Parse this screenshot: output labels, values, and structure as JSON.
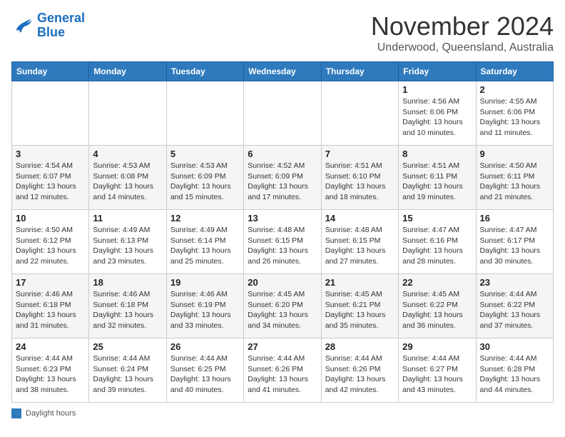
{
  "header": {
    "logo_line1": "General",
    "logo_line2": "Blue",
    "month": "November 2024",
    "location": "Underwood, Queensland, Australia"
  },
  "days_of_week": [
    "Sunday",
    "Monday",
    "Tuesday",
    "Wednesday",
    "Thursday",
    "Friday",
    "Saturday"
  ],
  "weeks": [
    [
      {
        "day": "",
        "info": ""
      },
      {
        "day": "",
        "info": ""
      },
      {
        "day": "",
        "info": ""
      },
      {
        "day": "",
        "info": ""
      },
      {
        "day": "",
        "info": ""
      },
      {
        "day": "1",
        "info": "Sunrise: 4:56 AM\nSunset: 6:06 PM\nDaylight: 13 hours\nand 10 minutes."
      },
      {
        "day": "2",
        "info": "Sunrise: 4:55 AM\nSunset: 6:06 PM\nDaylight: 13 hours\nand 11 minutes."
      }
    ],
    [
      {
        "day": "3",
        "info": "Sunrise: 4:54 AM\nSunset: 6:07 PM\nDaylight: 13 hours\nand 12 minutes."
      },
      {
        "day": "4",
        "info": "Sunrise: 4:53 AM\nSunset: 6:08 PM\nDaylight: 13 hours\nand 14 minutes."
      },
      {
        "day": "5",
        "info": "Sunrise: 4:53 AM\nSunset: 6:09 PM\nDaylight: 13 hours\nand 15 minutes."
      },
      {
        "day": "6",
        "info": "Sunrise: 4:52 AM\nSunset: 6:09 PM\nDaylight: 13 hours\nand 17 minutes."
      },
      {
        "day": "7",
        "info": "Sunrise: 4:51 AM\nSunset: 6:10 PM\nDaylight: 13 hours\nand 18 minutes."
      },
      {
        "day": "8",
        "info": "Sunrise: 4:51 AM\nSunset: 6:11 PM\nDaylight: 13 hours\nand 19 minutes."
      },
      {
        "day": "9",
        "info": "Sunrise: 4:50 AM\nSunset: 6:11 PM\nDaylight: 13 hours\nand 21 minutes."
      }
    ],
    [
      {
        "day": "10",
        "info": "Sunrise: 4:50 AM\nSunset: 6:12 PM\nDaylight: 13 hours\nand 22 minutes."
      },
      {
        "day": "11",
        "info": "Sunrise: 4:49 AM\nSunset: 6:13 PM\nDaylight: 13 hours\nand 23 minutes."
      },
      {
        "day": "12",
        "info": "Sunrise: 4:49 AM\nSunset: 6:14 PM\nDaylight: 13 hours\nand 25 minutes."
      },
      {
        "day": "13",
        "info": "Sunrise: 4:48 AM\nSunset: 6:15 PM\nDaylight: 13 hours\nand 26 minutes."
      },
      {
        "day": "14",
        "info": "Sunrise: 4:48 AM\nSunset: 6:15 PM\nDaylight: 13 hours\nand 27 minutes."
      },
      {
        "day": "15",
        "info": "Sunrise: 4:47 AM\nSunset: 6:16 PM\nDaylight: 13 hours\nand 28 minutes."
      },
      {
        "day": "16",
        "info": "Sunrise: 4:47 AM\nSunset: 6:17 PM\nDaylight: 13 hours\nand 30 minutes."
      }
    ],
    [
      {
        "day": "17",
        "info": "Sunrise: 4:46 AM\nSunset: 6:18 PM\nDaylight: 13 hours\nand 31 minutes."
      },
      {
        "day": "18",
        "info": "Sunrise: 4:46 AM\nSunset: 6:18 PM\nDaylight: 13 hours\nand 32 minutes."
      },
      {
        "day": "19",
        "info": "Sunrise: 4:46 AM\nSunset: 6:19 PM\nDaylight: 13 hours\nand 33 minutes."
      },
      {
        "day": "20",
        "info": "Sunrise: 4:45 AM\nSunset: 6:20 PM\nDaylight: 13 hours\nand 34 minutes."
      },
      {
        "day": "21",
        "info": "Sunrise: 4:45 AM\nSunset: 6:21 PM\nDaylight: 13 hours\nand 35 minutes."
      },
      {
        "day": "22",
        "info": "Sunrise: 4:45 AM\nSunset: 6:22 PM\nDaylight: 13 hours\nand 36 minutes."
      },
      {
        "day": "23",
        "info": "Sunrise: 4:44 AM\nSunset: 6:22 PM\nDaylight: 13 hours\nand 37 minutes."
      }
    ],
    [
      {
        "day": "24",
        "info": "Sunrise: 4:44 AM\nSunset: 6:23 PM\nDaylight: 13 hours\nand 38 minutes."
      },
      {
        "day": "25",
        "info": "Sunrise: 4:44 AM\nSunset: 6:24 PM\nDaylight: 13 hours\nand 39 minutes."
      },
      {
        "day": "26",
        "info": "Sunrise: 4:44 AM\nSunset: 6:25 PM\nDaylight: 13 hours\nand 40 minutes."
      },
      {
        "day": "27",
        "info": "Sunrise: 4:44 AM\nSunset: 6:26 PM\nDaylight: 13 hours\nand 41 minutes."
      },
      {
        "day": "28",
        "info": "Sunrise: 4:44 AM\nSunset: 6:26 PM\nDaylight: 13 hours\nand 42 minutes."
      },
      {
        "day": "29",
        "info": "Sunrise: 4:44 AM\nSunset: 6:27 PM\nDaylight: 13 hours\nand 43 minutes."
      },
      {
        "day": "30",
        "info": "Sunrise: 4:44 AM\nSunset: 6:28 PM\nDaylight: 13 hours\nand 44 minutes."
      }
    ]
  ],
  "legend": {
    "box_color": "#2e7abd",
    "label": "Daylight hours"
  }
}
